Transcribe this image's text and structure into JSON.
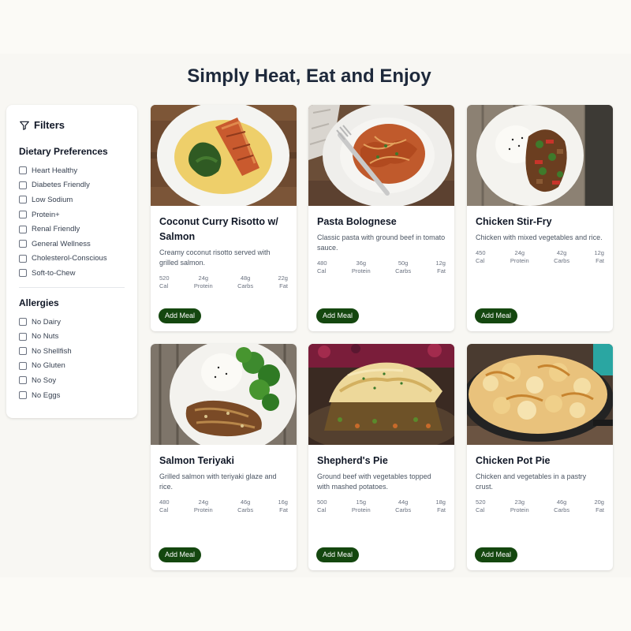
{
  "page": {
    "title": "Simply Heat, Eat and Enjoy"
  },
  "filters": {
    "title": "Filters",
    "dietary": {
      "title": "Dietary Preferences",
      "options": [
        "Heart Healthy",
        "Diabetes Friendly",
        "Low Sodium",
        "Protein+",
        "Renal Friendly",
        "General Wellness",
        "Cholesterol-Conscious",
        "Soft-to-Chew"
      ]
    },
    "allergies": {
      "title": "Allergies",
      "options": [
        "No Dairy",
        "No Nuts",
        "No Shellfish",
        "No Gluten",
        "No Soy",
        "No Eggs"
      ]
    }
  },
  "nutrient_labels": {
    "cal": "Cal",
    "protein": "Protein",
    "carbs": "Carbs",
    "fat": "Fat"
  },
  "add_label": "Add Meal",
  "meals": [
    {
      "name": "Coconut Curry Risotto w/ Salmon",
      "description": "Creamy coconut risotto served with grilled salmon.",
      "cal": "520",
      "protein": "24g",
      "carbs": "48g",
      "fat": "22g"
    },
    {
      "name": "Pasta Bolognese",
      "description": "Classic pasta with ground beef in tomato sauce.",
      "cal": "480",
      "protein": "36g",
      "carbs": "50g",
      "fat": "12g"
    },
    {
      "name": "Chicken Stir-Fry",
      "description": "Chicken with mixed vegetables and rice.",
      "cal": "450",
      "protein": "24g",
      "carbs": "42g",
      "fat": "12g"
    },
    {
      "name": "Salmon Teriyaki",
      "description": "Grilled salmon with teriyaki glaze and rice.",
      "cal": "480",
      "protein": "24g",
      "carbs": "46g",
      "fat": "16g"
    },
    {
      "name": "Shepherd's Pie",
      "description": "Ground beef with vegetables topped with mashed potatoes.",
      "cal": "500",
      "protein": "15g",
      "carbs": "44g",
      "fat": "18g"
    },
    {
      "name": "Chicken Pot Pie",
      "description": "Chicken and vegetables in a pastry crust.",
      "cal": "520",
      "protein": "23g",
      "carbs": "46g",
      "fat": "20g"
    }
  ]
}
